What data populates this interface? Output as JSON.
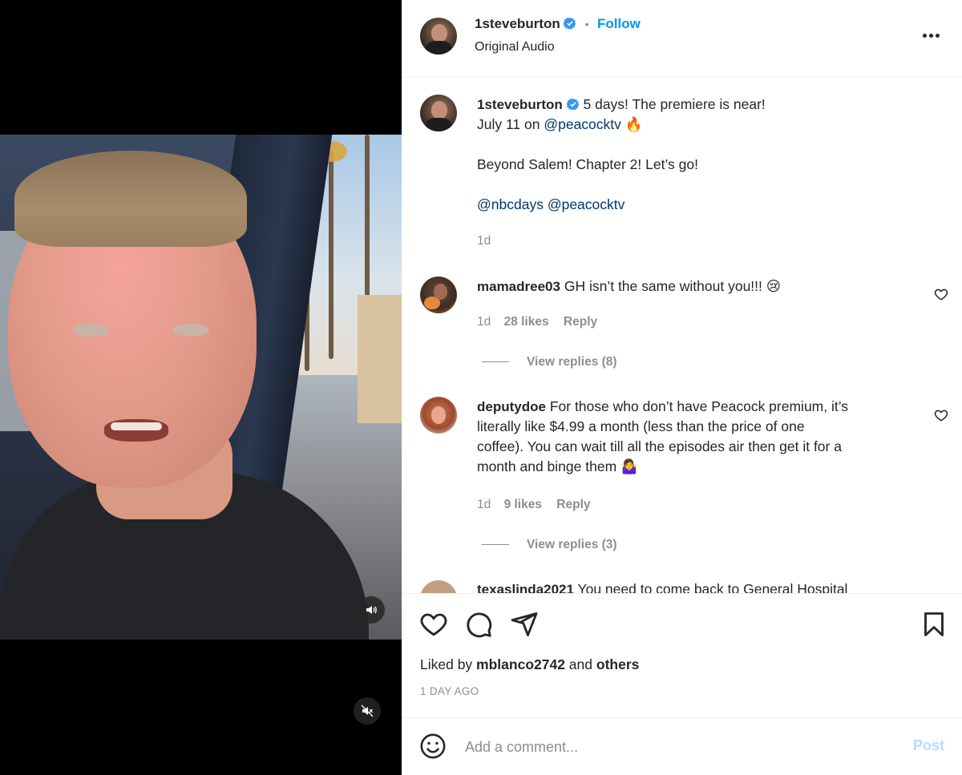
{
  "post": {
    "author": "1steveburton",
    "follow_label": "Follow",
    "dot": "•",
    "audio": "Original Audio",
    "more_label": "More options"
  },
  "caption": {
    "username": "1steveburton",
    "line1": "5 days! The premiere is near!",
    "line2_prefix": "July 11 on ",
    "line2_mention": "@peacocktv",
    "line2_emoji": "🔥",
    "line3": "Beyond Salem! Chapter 2! Let’s go!",
    "mention_a": "@nbcdays",
    "mention_b": "@peacocktv",
    "time": "1d"
  },
  "comments": [
    {
      "username": "mamadree03",
      "text": "GH isn’t the same without you!!! 😢",
      "time": "1d",
      "likes": "28 likes",
      "reply": "Reply",
      "view_replies": "View replies (8)"
    },
    {
      "username": "deputydoe",
      "text_line1": "For those who don’t have Peacock premium, it’s",
      "text_line2": "literally like $4.99 a month (less than the price of one",
      "text_line3": "coffee). You can wait till all the episodes air then get it for a",
      "text_line4": "month and binge them 🤷‍♀️",
      "time": "1d",
      "likes": "9 likes",
      "reply": "Reply",
      "view_replies": "View replies (3)"
    },
    {
      "username": "texaslinda2021",
      "text": "You need to come back to General Hospital"
    }
  ],
  "likes": {
    "prefix": "Liked by ",
    "user": "mblanco2742",
    "middle": " and ",
    "others": "others",
    "date": "1 DAY AGO"
  },
  "comment_box": {
    "placeholder": "Add a comment...",
    "post_label": "Post"
  },
  "colors": {
    "accent": "#0095f6",
    "link": "#00376b",
    "muted": "#8e8e8e",
    "post_disabled": "#b2dffc"
  },
  "icons": [
    "heart-icon",
    "comment-icon",
    "share-icon",
    "bookmark-icon",
    "emoji-icon",
    "volume-icon",
    "muted-icon",
    "verified-icon",
    "more-icon"
  ]
}
